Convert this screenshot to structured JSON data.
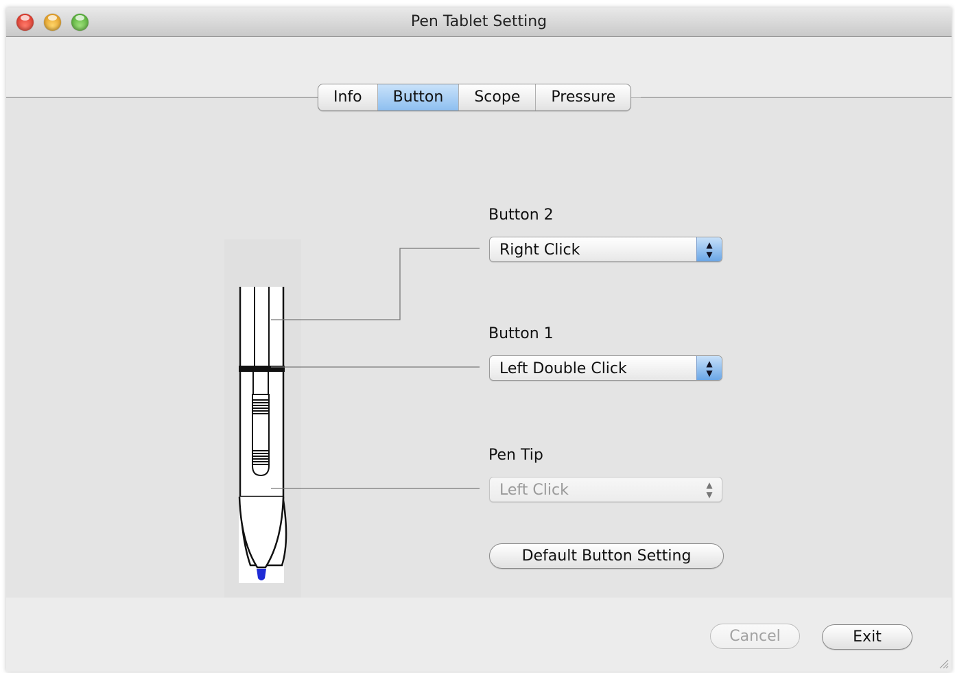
{
  "window": {
    "title": "Pen Tablet Setting"
  },
  "tabs": [
    {
      "label": "Info",
      "selected": false
    },
    {
      "label": "Button",
      "selected": true
    },
    {
      "label": "Scope",
      "selected": false
    },
    {
      "label": "Pressure",
      "selected": false
    }
  ],
  "buttons": {
    "button2": {
      "label": "Button 2",
      "value": "Right Click"
    },
    "button1": {
      "label": "Button 1",
      "value": "Left Double Click"
    },
    "pen_tip": {
      "label": "Pen Tip",
      "value": "Left Click",
      "enabled": false
    }
  },
  "default_button_setting": "Default Button Setting",
  "footer": {
    "cancel_label": "Cancel",
    "cancel_enabled": false,
    "exit_label": "Exit"
  },
  "colors": {
    "tab_selected": "#8ebff0",
    "pen_tip": "#1f2bd6"
  }
}
